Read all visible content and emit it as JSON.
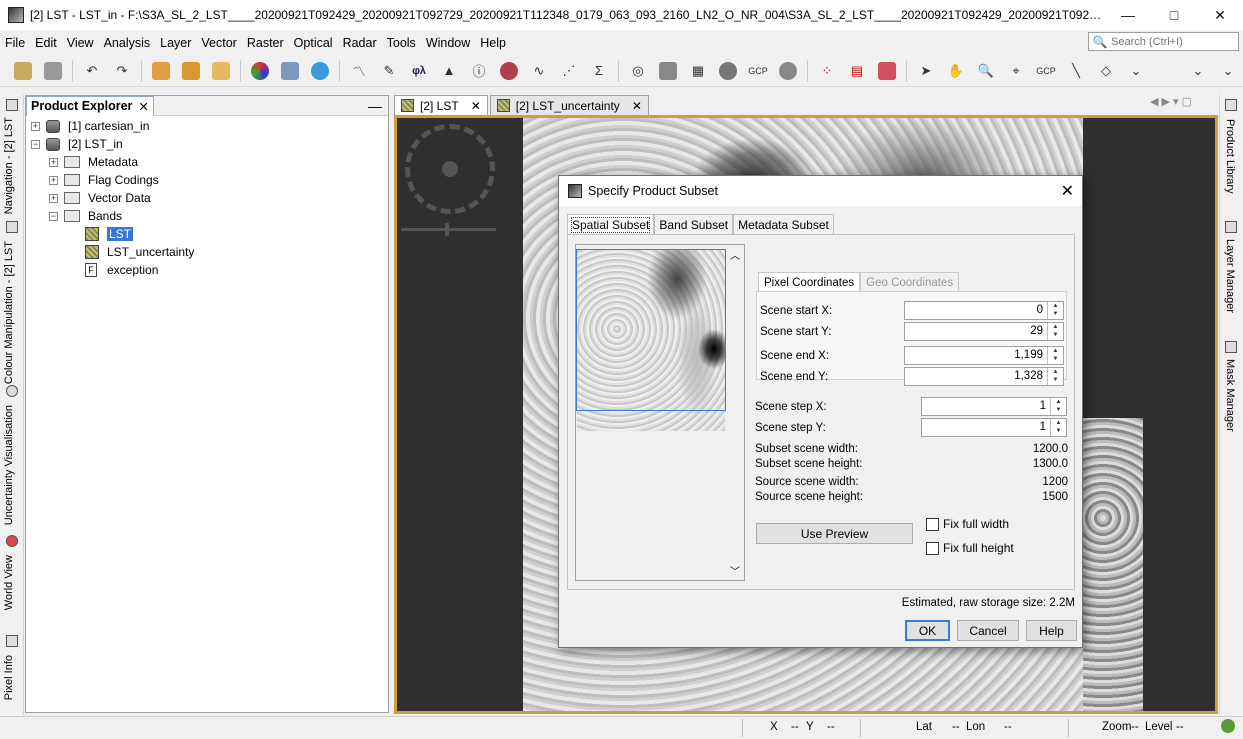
{
  "window": {
    "title": "[2] LST - LST_in - F:\\S3A_SL_2_LST____20200921T092429_20200921T092729_20200921T112348_0179_063_093_2160_LN2_O_NR_004\\S3A_SL_2_LST____20200921T092429_20200921T092729_20200921T112348_017...",
    "controls": [
      "—",
      "□",
      "✕"
    ]
  },
  "menu": [
    "File",
    "Edit",
    "View",
    "Analysis",
    "Layer",
    "Vector",
    "Raster",
    "Optical",
    "Radar",
    "Tools",
    "Window",
    "Help"
  ],
  "search": {
    "placeholder": "Search (Ctrl+I)"
  },
  "left_tabs": [
    "Navigation - [2] LST",
    "Colour Manipulation - [2] LST",
    "Uncertainty Visualisation",
    "World View",
    "Pixel Info"
  ],
  "right_tabs": [
    "Product Library",
    "Layer Manager",
    "Mask Manager"
  ],
  "explorer": {
    "title": "Product Explorer",
    "close": "✕",
    "minimize": "—",
    "nodes": [
      {
        "label": "[1] cartesian_in",
        "expander": "+"
      },
      {
        "label": "[2] LST_in",
        "expander": "−"
      },
      {
        "label": "Metadata",
        "expander": "+"
      },
      {
        "label": "Flag Codings",
        "expander": "+"
      },
      {
        "label": "Vector Data",
        "expander": "+"
      },
      {
        "label": "Bands",
        "expander": "−"
      },
      {
        "label": "LST"
      },
      {
        "label": "LST_uncertainty"
      },
      {
        "label": "exception"
      }
    ]
  },
  "doc_tabs": [
    {
      "label": "[2] LST",
      "close": "✕"
    },
    {
      "label": "[2] LST_uncertainty",
      "close": "✕"
    }
  ],
  "tab_nav": "◀ ▶ ▾ ▢",
  "status": {
    "x_label": "X",
    "x_val": "--",
    "y_label": "Y",
    "y_val": "--",
    "lat_label": "Lat",
    "lat_val": "--",
    "lon_label": "Lon",
    "lon_val": "--",
    "zoom_label": "Zoom",
    "zoom_val": "--",
    "level_label": "Level",
    "level_val": "--"
  },
  "dialog": {
    "title": "Specify Product Subset",
    "close": "✕",
    "tabs": [
      "Spatial Subset",
      "Band Subset",
      "Metadata Subset"
    ],
    "coord_tabs": [
      "Pixel Coordinates",
      "Geo Coordinates"
    ],
    "fields": [
      {
        "label": "Scene start X:",
        "value": "0"
      },
      {
        "label": "Scene start Y:",
        "value": "29"
      },
      {
        "label": "Scene end X:",
        "value": "1,199"
      },
      {
        "label": "Scene end Y:",
        "value": "1,328"
      },
      {
        "label": "Scene step X:",
        "value": "1"
      },
      {
        "label": "Scene step Y:",
        "value": "1"
      }
    ],
    "info": [
      {
        "label": "Subset scene width:",
        "value": "1200.0"
      },
      {
        "label": "Subset scene height:",
        "value": "1300.0"
      },
      {
        "label": "Source scene width:",
        "value": "1200"
      },
      {
        "label": "Source scene height:",
        "value": "1500"
      }
    ],
    "use_preview": "Use Preview",
    "fix_width": "Fix full width",
    "fix_height": "Fix full height",
    "estimate": "Estimated, raw storage size: 2.2M",
    "ok": "OK",
    "cancel": "Cancel",
    "help": "Help"
  }
}
